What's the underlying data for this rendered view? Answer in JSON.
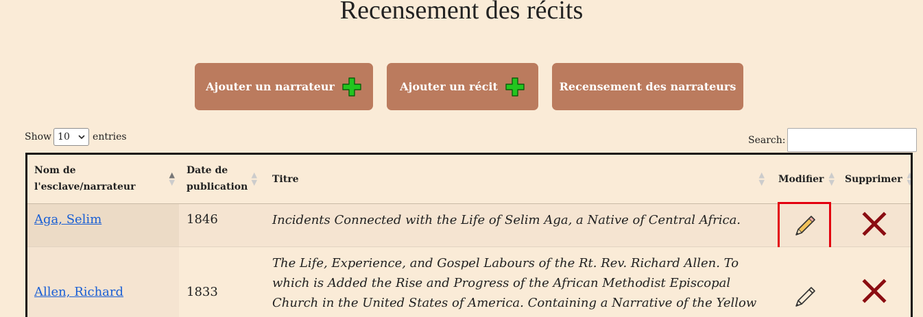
{
  "page": {
    "title": "Recensement des récits"
  },
  "buttons": {
    "add_narrator": "Ajouter un narrateur",
    "add_narrative": "Ajouter un récit",
    "narrators_census": "Recensement des narrateurs"
  },
  "length_control": {
    "show_label": "Show",
    "selected": "10",
    "entries_label": "entries"
  },
  "search": {
    "label": "Search:",
    "value": ""
  },
  "table": {
    "columns": {
      "name_line1": "Nom de",
      "name_line2": "l'esclave/narrateur",
      "date_line1": "Date de",
      "date_line2": "publication",
      "title": "Titre",
      "edit": "Modifier",
      "delete": "Supprimer"
    },
    "rows": [
      {
        "name": "Aga, Selim",
        "date": "1846",
        "title": "Incidents Connected with the Life of Selim Aga, a Native of Central Africa."
      },
      {
        "name": "Allen, Richard",
        "date": "1833",
        "title": "The Life, Experience, and Gospel Labours of the Rt. Rev. Richard Allen. To which is Added the Rise and Progress of the African Methodist Episcopal Church in the United States of America. Containing a Narrative of the Yellow Fever in the Year of our Lord"
      }
    ]
  },
  "colors": {
    "background": "#faebd7",
    "button": "#bb7b5e",
    "plus": "#22c51f",
    "delete": "#8b0d12",
    "highlight": "#e3000f",
    "link": "#1a5fd4"
  },
  "icons": {
    "add": "plus-icon",
    "edit": "pencil-icon",
    "delete": "x-icon",
    "sort": "sort-arrows-icon",
    "select": "chevron-down-icon"
  }
}
